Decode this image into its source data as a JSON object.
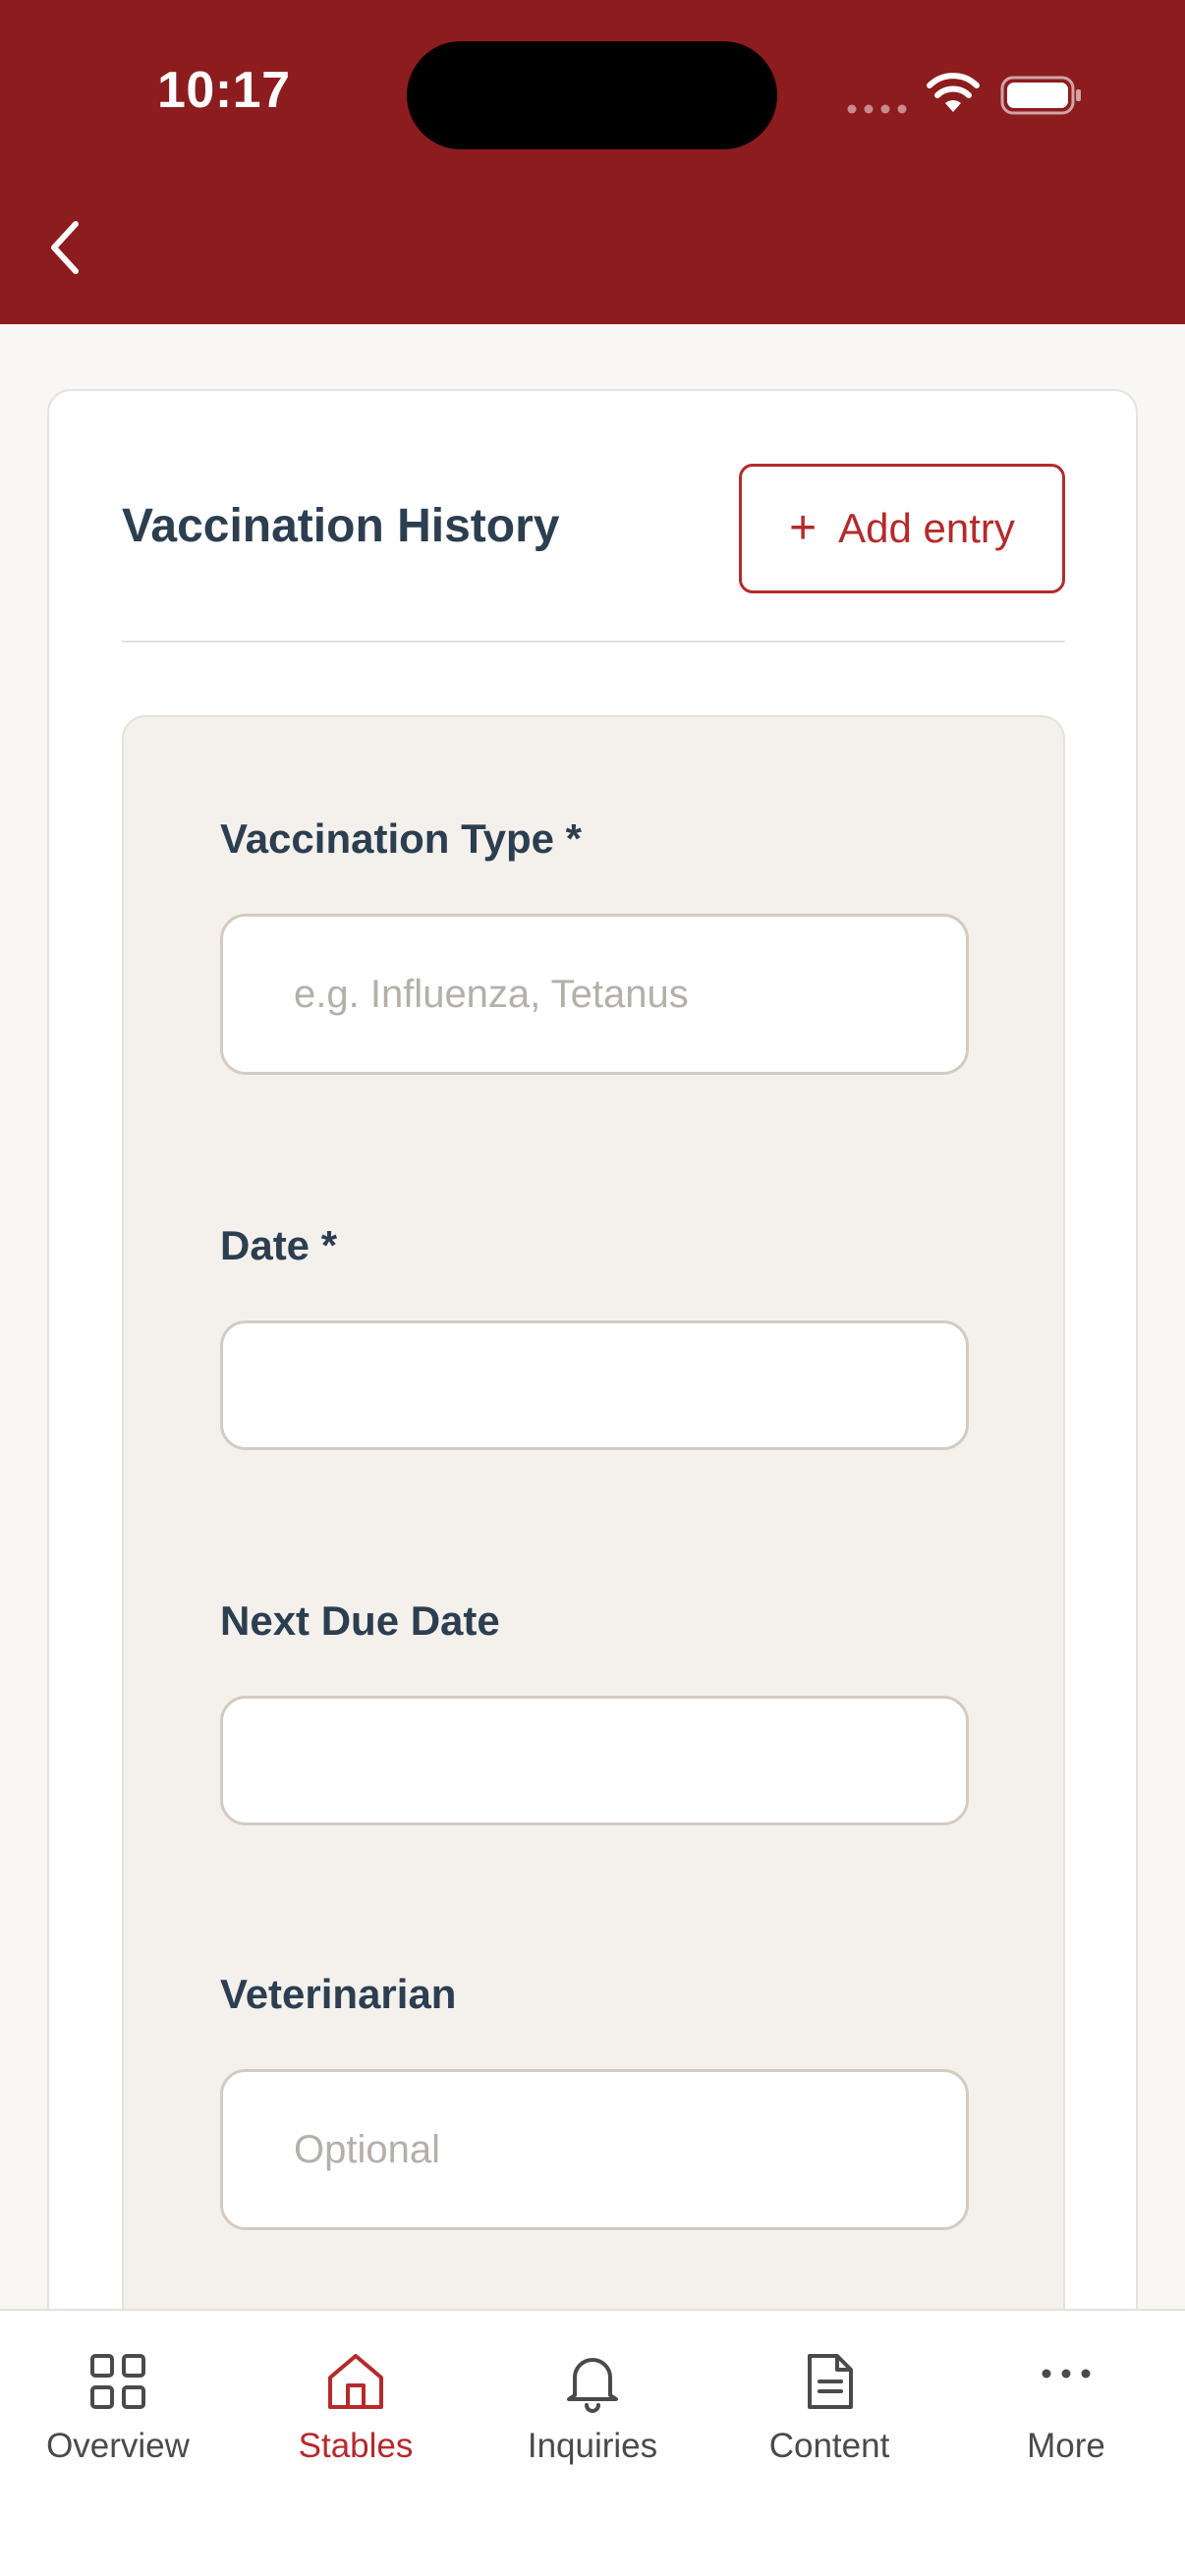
{
  "status_bar": {
    "time": "10:17"
  },
  "card": {
    "title": "Vaccination History",
    "add_entry_label": "Add entry",
    "add_entry_icon": "plus-icon"
  },
  "form": {
    "vaccination_type": {
      "label": "Vaccination Type *",
      "value": "",
      "placeholder": "e.g. Influenza, Tetanus"
    },
    "date": {
      "label": "Date *",
      "value": "",
      "placeholder": ""
    },
    "next_due_date": {
      "label": "Next Due Date",
      "value": "",
      "placeholder": ""
    },
    "veterinarian": {
      "label": "Veterinarian",
      "value": "",
      "placeholder": "Optional"
    }
  },
  "tabbar": {
    "items": [
      {
        "label": "Overview",
        "icon": "grid-icon",
        "active": false
      },
      {
        "label": "Stables",
        "icon": "home-icon",
        "active": true
      },
      {
        "label": "Inquiries",
        "icon": "bell-icon",
        "active": false
      },
      {
        "label": "Content",
        "icon": "document-icon",
        "active": false
      },
      {
        "label": "More",
        "icon": "more-dots-icon",
        "active": false
      }
    ]
  },
  "colors": {
    "header": "#8c1c1e",
    "accent": "#b52a2b",
    "text_dark": "#2c3e50",
    "panel_bg": "#f4f1ed"
  }
}
